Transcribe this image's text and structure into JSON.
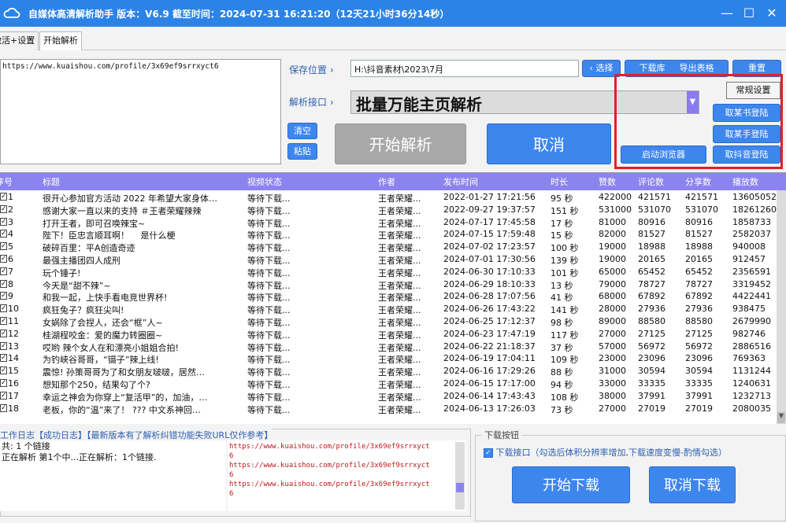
{
  "window": {
    "title": "自媒体高清解析助手 版本：V6.9    截至时间：2024-07-31 16:21:20（12天21小时36分14秒）",
    "minimize": "—",
    "maximize": "☐",
    "close": "✕"
  },
  "tabs": [
    {
      "label": "激活+设置"
    },
    {
      "label": "开始解析"
    }
  ],
  "urls_text": "https://www.kuaishou.com/profile/3x69ef9srrxyct6",
  "save": {
    "label": "保存位置",
    "path": "H:\\抖音素材\\2023\\7月",
    "choose": "选择",
    "download_lib": "下载库",
    "export_table": "导出表格",
    "reset": "重置"
  },
  "parse": {
    "label": "解析接口",
    "selected": "批量万能主页解析"
  },
  "buttons": {
    "clear": "清空",
    "paste": "粘贴",
    "start_parse": "开始解析",
    "cancel": "取消",
    "start_browser": "启动浏览器"
  },
  "settings": {
    "normal": "常规设置",
    "login_xhs": "取某书登陆",
    "login_ks": "取某手登陆",
    "login_dy": "取抖音登陆"
  },
  "table": {
    "headers": [
      "序号",
      "标题",
      "视频状态",
      "作者",
      "发布时间",
      "时长",
      "赞数",
      "评论数",
      "分享数",
      "播放数"
    ],
    "rows": [
      [
        "1",
        "很开心参加官方活动 2022 年希望大家身体…",
        "等待下载...",
        "王者荣耀...",
        "2022-01-27 17:21:56",
        "95 秒",
        "422000",
        "421571",
        "421571",
        "13605052"
      ],
      [
        "2",
        "感谢大家一直以来的支持 ＃王者荣耀辣辣",
        "等待下载...",
        "王者荣耀...",
        "2022-09-27 19:37:57",
        "151 秒",
        "531000",
        "531070",
        "531070",
        "18261260"
      ],
      [
        "3",
        "打开王者，即可召唤辣宝~",
        "等待下载...",
        "王者荣耀...",
        "2024-07-17 17:45:58",
        "17 秒",
        "81000",
        "80916",
        "80916",
        "1858733"
      ],
      [
        "4",
        "陛下！臣忠言顺耳啊！　 是什么梗",
        "等待下载...",
        "王者荣耀...",
        "2024-07-15 17:59:48",
        "15 秒",
        "82000",
        "81527",
        "81527",
        "2582037"
      ],
      [
        "5",
        "破碎百里：平A创造奇迹",
        "等待下载...",
        "王者荣耀...",
        "2024-07-02 17:23:57",
        "100 秒",
        "19000",
        "18988",
        "18988",
        "940008"
      ],
      [
        "6",
        "最强主播团四人成刑",
        "等待下载...",
        "王者荣耀...",
        "2024-07-01 17:30:56",
        "139 秒",
        "19000",
        "20165",
        "20165",
        "912457"
      ],
      [
        "7",
        "玩个锤子!",
        "等待下载...",
        "王者荣耀...",
        "2024-06-30 17:10:33",
        "101 秒",
        "65000",
        "65452",
        "65452",
        "2356591"
      ],
      [
        "8",
        "今天是“甜不辣”~",
        "等待下载...",
        "王者荣耀...",
        "2024-06-29 18:10:33",
        "13 秒",
        "79000",
        "78727",
        "78727",
        "3319452"
      ],
      [
        "9",
        "和我一起，上快手看电竞世界杯!",
        "等待下载...",
        "王者荣耀...",
        "2024-06-28 17:07:56",
        "41 秒",
        "68000",
        "67892",
        "67892",
        "4422441"
      ],
      [
        "10",
        "疯狂兔子？疯狂尖叫!",
        "等待下载...",
        "王者荣耀...",
        "2024-06-26 17:43:22",
        "141 秒",
        "28000",
        "27936",
        "27936",
        "938475"
      ],
      [
        "11",
        "女娲除了会捏人，还会“框”人~",
        "等待下载...",
        "王者荣耀...",
        "2024-06-25 17:12:37",
        "98 秒",
        "89000",
        "88580",
        "88580",
        "2679990"
      ],
      [
        "12",
        "桂湖程咬金：爱的魔力转圈圈~",
        "等待下载...",
        "王者荣耀...",
        "2024-06-23 17:47:19",
        "117 秒",
        "27000",
        "27125",
        "27125",
        "982746"
      ],
      [
        "13",
        "哎哟 辣个女人在和漂亮小姐姐合拍!",
        "等待下载...",
        "王者荣耀...",
        "2024-06-22 21:18:37",
        "37 秒",
        "57000",
        "56972",
        "56972",
        "2886516"
      ],
      [
        "14",
        "为钓峡谷哥哥，“镊子”辣上线!",
        "等待下载...",
        "王者荣耀...",
        "2024-06-19 17:04:11",
        "109 秒",
        "23000",
        "23096",
        "23096",
        "769363"
      ],
      [
        "15",
        "震惊! 孙策哥哥为了和女朋友啵啵，居然…",
        "等待下载...",
        "王者荣耀...",
        "2024-06-16 17:29:26",
        "88 秒",
        "31000",
        "30594",
        "30594",
        "1131244"
      ],
      [
        "16",
        "想知那个250，结果勾了个?",
        "等待下载...",
        "王者荣耀...",
        "2024-06-15 17:17:00",
        "94 秒",
        "33000",
        "33335",
        "33335",
        "1240631"
      ],
      [
        "17",
        "幸运之神会为你穿上“复活甲”的，加油，…",
        "等待下载...",
        "王者荣耀...",
        "2024-06-14 17:43:43",
        "108 秒",
        "38000",
        "37991",
        "37991",
        "1232713"
      ],
      [
        "18",
        "老板，你的“温”来了！ ??? 中文系神回…",
        "等待下载...",
        "王者荣耀...",
        "2024-06-13 17:26:03",
        "73 秒",
        "27000",
        "27019",
        "27019",
        "2080035"
      ]
    ]
  },
  "log": {
    "title": "工作日志【成功日志】【最新版本有了解析纠错功能失败URL仅作参考】",
    "left_lines": [
      "共: 1 个链接",
      "正在解析 第1个中...正在解析：1个链接."
    ],
    "right_lines": [
      "https://www.kuaishou.com/profile/3x69ef9srrxyct",
      "6",
      "https://www.kuaishou.com/profile/3x69ef9srrxyct",
      "6",
      "https://www.kuaishou.com/profile/3x69ef9srrxyct",
      "6"
    ]
  },
  "download": {
    "group_title": "下载按钮",
    "checkbox_label": "下载接口（勾选后体积分辨率增加,下载速度变慢-酌情勾选）",
    "checked": true,
    "start": "开始下载",
    "cancel": "取消下载"
  },
  "colors": {
    "title_bar": "#2b83e8",
    "header": "#8b84ef",
    "button_blue": "#3d86ee",
    "red_box": "#e41e2a",
    "gray_button": "#a8a8a8",
    "log_url": "#c01818"
  }
}
